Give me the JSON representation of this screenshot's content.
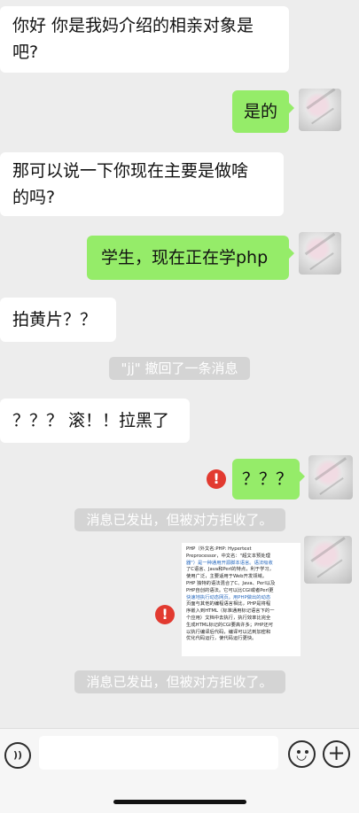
{
  "messages": [
    {
      "text_line1": "你好 你是我妈介绍的相亲对象是",
      "text_line2": "吧?"
    },
    {
      "text": "是的"
    },
    {
      "text_line1": "那可以说一下你现在主要是做啥",
      "text_line2": "的吗?"
    },
    {
      "text": "学生，现在正在学php"
    },
    {
      "text": "拍黄片？？"
    },
    {
      "text": "\"jj\" 撤回了一条消息"
    },
    {
      "text": "？？？ 滚！！拉黑了"
    },
    {
      "text": "？？？"
    },
    {
      "text": "消息已发出，但被对方拒收了。"
    },
    {
      "text": "消息已发出，但被对方拒收了。"
    }
  ],
  "error_mark": "!",
  "image_message": {
    "lines": [
      "PHP（外文名:PHP: Hypertext",
      "Preprocessor，中文名：\"超文本预处理",
      "器\"）是一种通用开源脚本语言。语法吸收",
      "了C语言、Java和Perl的特点，利于学习，",
      "使用广泛，主要适用于Web开发领域。",
      "PHP 独特的语法混合了C、Java、Perl以及",
      "PHP自创的语法。它可以比CGI或者Perl更",
      "快速地执行动态网页。用PHP做出的动态",
      "页面与其他的编程语言相比，PHP是将程",
      "序嵌入到HTML（标准通用标记语言下的一",
      "个应用）文档中去执行，执行效率比完全",
      "生成HTML标记的CGI要高许多；PHP还可",
      "以执行编译后代码，编译可以达到加密和",
      "优化代码运行，使代码运行更快。"
    ]
  },
  "input_bar": {
    "voice_icon": "))",
    "emoji_icon": "◡",
    "plus_icon": "+"
  },
  "colors": {
    "background": "#ededed",
    "sent_bubble": "#95ec69",
    "received_bubble": "#ffffff",
    "error": "#e23a30"
  }
}
